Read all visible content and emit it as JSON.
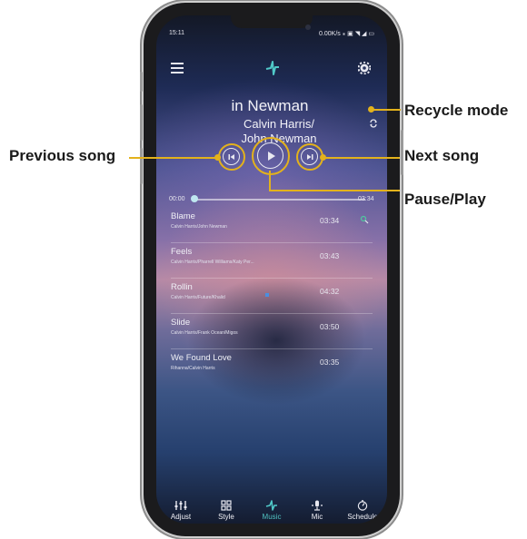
{
  "callouts": {
    "recycle": "Recycle mode",
    "previous": "Previous song",
    "next": "Next song",
    "play": "Pause/Play"
  },
  "status_bar": {
    "time": "15:11",
    "right": "0.00K/s ⁎ ▣ ◥ ◢ ▭"
  },
  "now_playing": {
    "title": "in Newman",
    "artist_line1": "Calvin Harris/",
    "artist_line2": "John Newman",
    "elapsed": "00:00",
    "total": "03:34",
    "progress": 0.0
  },
  "songs": [
    {
      "name": "Blame",
      "artists": "Calvin Harris/John Newman",
      "duration": "03:34"
    },
    {
      "name": "Feels",
      "artists": "Calvin Harris/Pharrell Williams/Katy Per...",
      "duration": "03:43"
    },
    {
      "name": "Rollin",
      "artists": "Calvin Harris/Future/Khalid",
      "duration": "04:32"
    },
    {
      "name": "Slide",
      "artists": "Calvin Harris/Frank Ocean/Migos",
      "duration": "03:50"
    },
    {
      "name": "We Found Love",
      "artists": "Rihanna/Calvin Harris",
      "duration": "03:35"
    }
  ],
  "nav": [
    {
      "label": "Adjust",
      "icon": "sliders-icon"
    },
    {
      "label": "Style",
      "icon": "grid-icon"
    },
    {
      "label": "Music",
      "icon": "music-icon",
      "active": true
    },
    {
      "label": "Mic",
      "icon": "mic-icon"
    },
    {
      "label": "Schedule",
      "icon": "timer-icon"
    }
  ],
  "colors": {
    "callout_accent": "#e3b21c",
    "active_tab": "#50c0c0"
  }
}
